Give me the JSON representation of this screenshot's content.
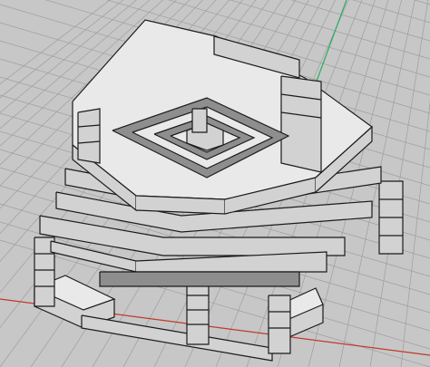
{
  "viewport": {
    "name": "perspective-viewport",
    "background": "#c7c7c7",
    "grid_color": "#9e9e9e",
    "axis_x_color": "#c0392b",
    "axis_y_color": "#27ae60",
    "shading": "light-gray-faces-black-edges"
  },
  "model": {
    "description_icon": "stepped-pyramid-model"
  }
}
